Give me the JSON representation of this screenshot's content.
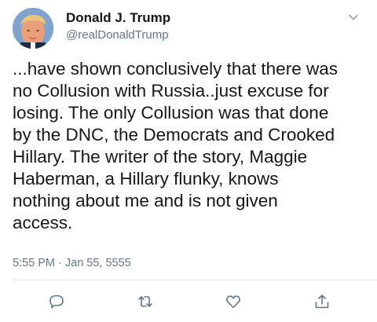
{
  "tweet": {
    "author_name": "Donald J. Trump",
    "author_handle": "@realDonaldTrump",
    "text": "...have shown conclusively that there was\nno Collusion with Russia..just excuse for\nlosing. The only Collusion was that done\nby the DNC, the Democrats and Crooked\nHillary. The writer of the story, Maggie\nHaberman, a Hillary flunky, knows\nnothing about me and is not given\naccess.",
    "timestamp": "5:55 PM · Jan 55, 5555"
  },
  "icons": {
    "menu": "chevron-down-icon",
    "reply": "reply-icon",
    "retweet": "retweet-icon",
    "like": "heart-icon",
    "share": "share-icon"
  },
  "colors": {
    "text": "#14171a",
    "secondary": "#657786",
    "divider": "#e1e8ed",
    "action_icon": "#657786"
  }
}
